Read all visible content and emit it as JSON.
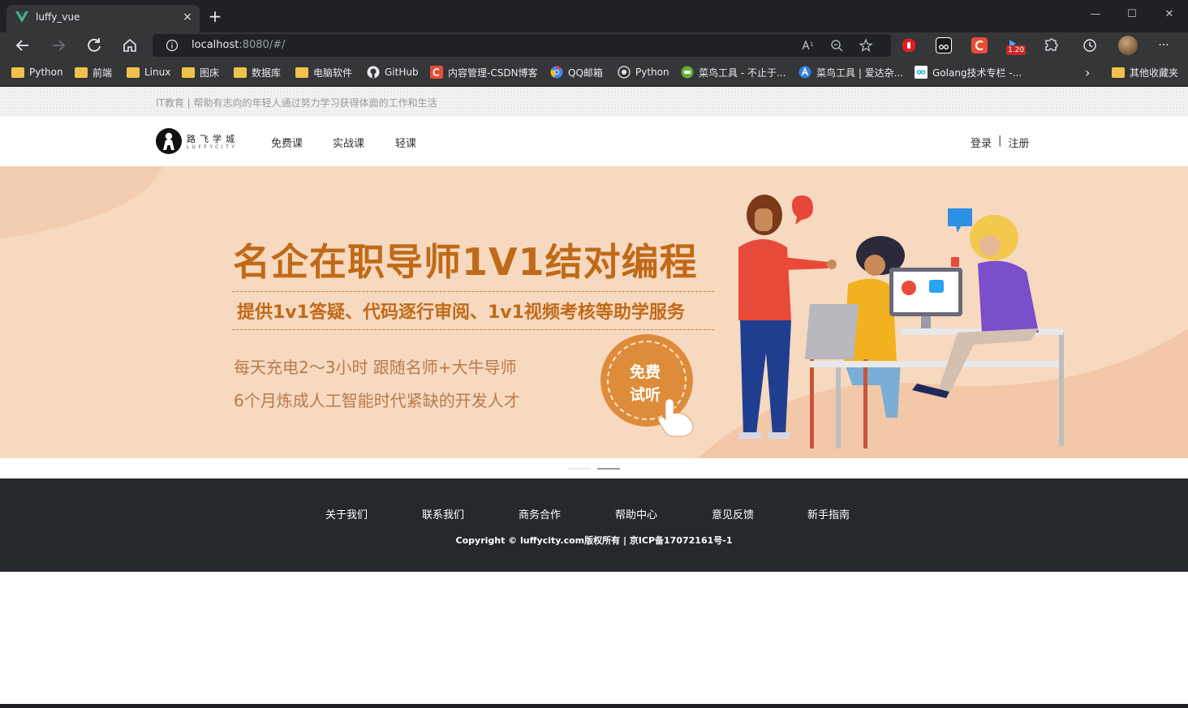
{
  "browser": {
    "tab_title": "luffy_vue",
    "tab_close": "×",
    "new_tab": "+",
    "window_min": "—",
    "window_max": "☐",
    "window_close": "✕",
    "url_host": "localhost",
    "url_path": ":8080/#/",
    "extension_badge": "1.20",
    "menu_dots": "···"
  },
  "bookmarks": {
    "items": [
      {
        "label": "Python",
        "icon": "folder-icon"
      },
      {
        "label": "前端",
        "icon": "folder-icon"
      },
      {
        "label": "Linux",
        "icon": "folder-icon"
      },
      {
        "label": "图床",
        "icon": "folder-icon"
      },
      {
        "label": "数据库",
        "icon": "folder-icon"
      },
      {
        "label": "电脑软件",
        "icon": "folder-icon"
      },
      {
        "label": "GitHub",
        "icon": "github-icon"
      },
      {
        "label": "内容管理-CSDN博客",
        "icon": "csdn-icon"
      },
      {
        "label": "QQ邮箱",
        "icon": "chrome-icon"
      },
      {
        "label": "Python",
        "icon": "python-icon"
      },
      {
        "label": "菜鸟工具 - 不止于...",
        "icon": "runoob-icon"
      },
      {
        "label": "菜鸟工具 | 爱达杂...",
        "icon": "a-icon"
      },
      {
        "label": "Golang技术专栏 -...",
        "icon": "go-icon"
      }
    ],
    "more": "›",
    "other": "其他收藏夹"
  },
  "page": {
    "slogan": "IT教育 | 帮助有志向的年轻人通过努力学习获得体面的工作和生活",
    "logo_cn": "路飞学城",
    "logo_en": "LUFFYCITY",
    "nav": [
      "免费课",
      "实战课",
      "轻课"
    ],
    "login": "登录",
    "separator": "|",
    "register": "注册"
  },
  "banner": {
    "title": "名企在职导师1V1结对编程",
    "subtitle": "提供1v1答疑、代码逐行审阅、1v1视频考核等助学服务",
    "line1": "每天充电2～3小时  跟随名师+大牛导师",
    "line2": "6个月炼成人工智能时代紧缺的开发人才",
    "button_line1": "免费",
    "button_line2": "试听"
  },
  "carousel": {
    "count": 2,
    "active": 2
  },
  "footer": {
    "links": [
      "关于我们",
      "联系我们",
      "商务合作",
      "帮助中心",
      "意见反馈",
      "新手指南"
    ],
    "copyright": "Copyright © luffycity.com版权所有 | 京ICP备17072161号-1"
  },
  "colors": {
    "banner_bg": "#f7d9c0",
    "accent_orange": "#c06a18",
    "footer_bg": "#25292e"
  }
}
